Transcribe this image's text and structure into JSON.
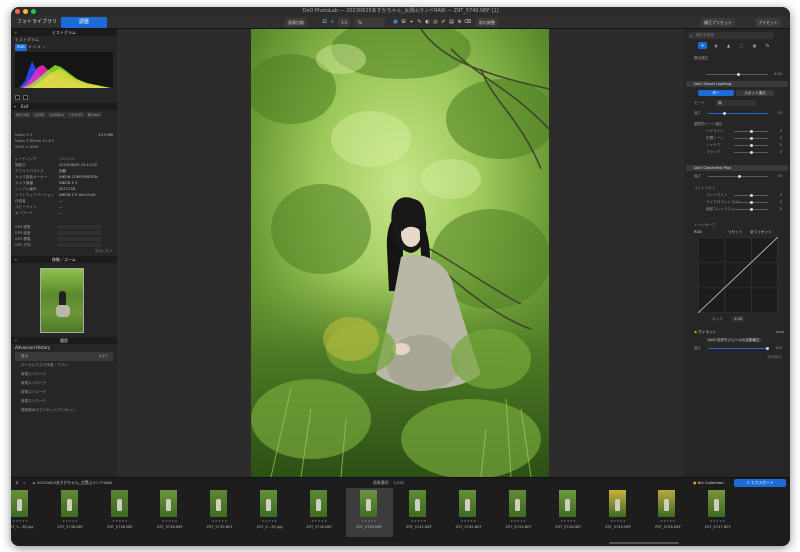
{
  "window": {
    "title": "DxO PhotoLab — 20230625あすかちゃん_太閤山ランドRAW — Z9T_5740.NEF [1]"
  },
  "toolbar": {
    "tab_library": "フォトライブラリ",
    "tab_customize": "調整",
    "compare": "画像比較",
    "zoom": "1:1",
    "zoom_percent": "% ",
    "before_after": "前の調整",
    "copy_preset": "補正プリセット",
    "apply_preset": "プリセット"
  },
  "left_panel": {
    "histogram_title": "ヒストグラム",
    "histogram_label": "ヒストグラム",
    "channels": [
      "RGB",
      "R",
      "G",
      "B",
      "L"
    ],
    "exif_title": "Exif",
    "exif_values": [
      "ISO 100",
      "1/250",
      "1/2000 s",
      "+0.0 EV",
      "85 mm"
    ],
    "camera": "Nikon Z 9",
    "file_size": "53.5 MB",
    "lens": "Nikon Z 85mm f/1.8 S",
    "dims": "5504 × 8256",
    "meta_rows": [
      {
        "label": "レーティング",
        "value": "☆☆☆☆☆"
      },
      {
        "label": "撮影日",
        "value": "2023/06/25 15:11:02"
      },
      {
        "label": "ホワイトバランス",
        "value": "自動"
      },
      {
        "label": "カメラ製造メーカー",
        "value": "NIKON CORPORATION"
      },
      {
        "label": "カメラ機種",
        "value": "NIKON Z 9"
      },
      {
        "label": "シリアル番号",
        "value": "3011738"
      },
      {
        "label": "ソフトウェアバージョン",
        "value": "NIKON Z 9 Ver.04.00"
      },
      {
        "label": "作成者",
        "value": "—"
      },
      {
        "label": "コピーライト",
        "value": "—"
      },
      {
        "label": "キーワード",
        "value": "—"
      }
    ],
    "gps_rows": [
      "GPS 緯度",
      "GPS 経度",
      "GPS 標高",
      "GPS 方向"
    ],
    "reset_label": "既定に戻す",
    "navigator_title": "移動／ズーム",
    "history_title": "履歴",
    "history_header": "Advanced History",
    "history_items": [
      {
        "label": "露出",
        "value": "0.27"
      },
      {
        "label": "ローカルマスク作成・ブラシ",
        "value": ""
      },
      {
        "label": "新規ストローク",
        "value": ""
      },
      {
        "label": "新規ストローク",
        "value": ""
      },
      {
        "label": "新規ストローク",
        "value": ""
      },
      {
        "label": "新規ストローク",
        "value": ""
      },
      {
        "label": "適用済みのプリセット/プリセット",
        "value": ""
      }
    ]
  },
  "right_panel": {
    "search_placeholder": "補正を検索",
    "exposure_label": "露出補正",
    "exposure_value": "0.00",
    "smart_lighting": "DxO Smart Lighting",
    "mode_even": "均一",
    "mode_spot": "スポット重点",
    "mode_label": "モード",
    "mode_value": "弱",
    "strength_label": "強さ",
    "strength_value": "25",
    "tone_title": "選択的トーン補正",
    "tone_rows": [
      {
        "label": "ハイライト",
        "value": "0"
      },
      {
        "label": "中間トーン",
        "value": "0"
      },
      {
        "label": "シャドウ",
        "value": "0"
      },
      {
        "label": "ブラック",
        "value": "0"
      }
    ],
    "clearview": "DxO ClearView Plus",
    "clearview_label": "強さ",
    "clearview_value": "50",
    "contrast_title": "コントラスト",
    "contrast_rows": [
      {
        "label": "コントラスト",
        "value": "0"
      },
      {
        "label": "マイクロコントラスト",
        "value": "0"
      },
      {
        "label": "細部コントラスト",
        "value": "0"
      }
    ],
    "curve_title": "トーンカーブ",
    "curve_channel": "RGB",
    "curve_reset": "リセット",
    "curve_reset_all": "全てリセット",
    "gamma_label": "ガンマ",
    "gamma_value": "1.00",
    "vignette_title": "ヴィネット",
    "vignette_mode": "Auto",
    "vignette_profile": "DxO 光学モジュールの自動補正",
    "vignette_strength_label": "強さ",
    "vignette_strength_value": "100",
    "vignette_advanced": "詳細設定"
  },
  "filmstrip": {
    "folder": "20230625あすかちゃん_太閤山ランドRAW",
    "selection_label": "画像選択：",
    "counter": "1/192",
    "collection": "Nik Collection",
    "export": "エクスポート",
    "thumbnails": [
      {
        "name": "Z9T_5...38.jpg",
        "color": "#6b8f3c"
      },
      {
        "name": "Z9T_5738.NEF",
        "color": "#5f8a36"
      },
      {
        "name": "Z9T_5738.NEF",
        "color": "#5a8434"
      },
      {
        "name": "Z9T_5738.NEF",
        "color": "#6a9540"
      },
      {
        "name": "Z9T_5739.NEF",
        "color": "#5d8838"
      },
      {
        "name": "Z9T_5...39.jpg",
        "color": "#64913c"
      },
      {
        "name": "Z9T_5740.NEF",
        "color": "#5b8a35"
      },
      {
        "name": "Z9T_5740.NEF",
        "color": "#6a953f"
      },
      {
        "name": "Z9T_5741.NEF",
        "color": "#5e8c37"
      },
      {
        "name": "Z9T_5742.NEF",
        "color": "#648f3a"
      },
      {
        "name": "Z9T_5743.NEF",
        "color": "#5f8a36"
      },
      {
        "name": "Z9T_5744.NEF",
        "color": "#6b9a3f"
      },
      {
        "name": "Z9T_5745.NEF",
        "color": "#c8b23a"
      },
      {
        "name": "Z9T_5746.NEF",
        "color": "#b7a83a"
      },
      {
        "name": "Z9T_5747.NEF",
        "color": "#78963a"
      }
    ]
  },
  "colors": {
    "accent": "#1c6cd8",
    "panel": "#262626",
    "viewer": "#2c2c2c"
  }
}
